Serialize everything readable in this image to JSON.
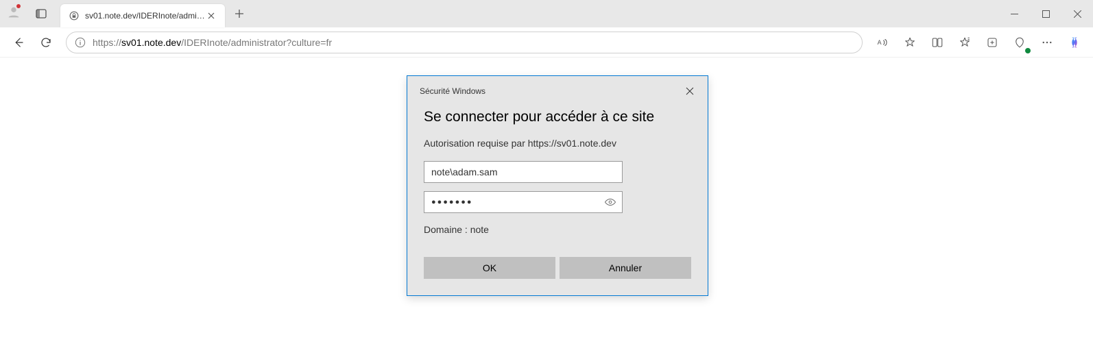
{
  "window": {
    "minimize": "—",
    "maximize": "▢",
    "close": "✕"
  },
  "tab": {
    "title": "sv01.note.dev/IDERInote/administ"
  },
  "addressbar": {
    "protocol": "https://",
    "host": "sv01.note.dev",
    "path": "/IDERInote/administrator?culture=fr"
  },
  "dialog": {
    "header": "Sécurité Windows",
    "title": "Se connecter pour accéder à ce site",
    "subtitle": "Autorisation requise par https://sv01.note.dev",
    "username": "note\\adam.sam",
    "password_display": "●●●●●●●",
    "domain_label": "Domaine : note",
    "ok_label": "OK",
    "cancel_label": "Annuler"
  }
}
